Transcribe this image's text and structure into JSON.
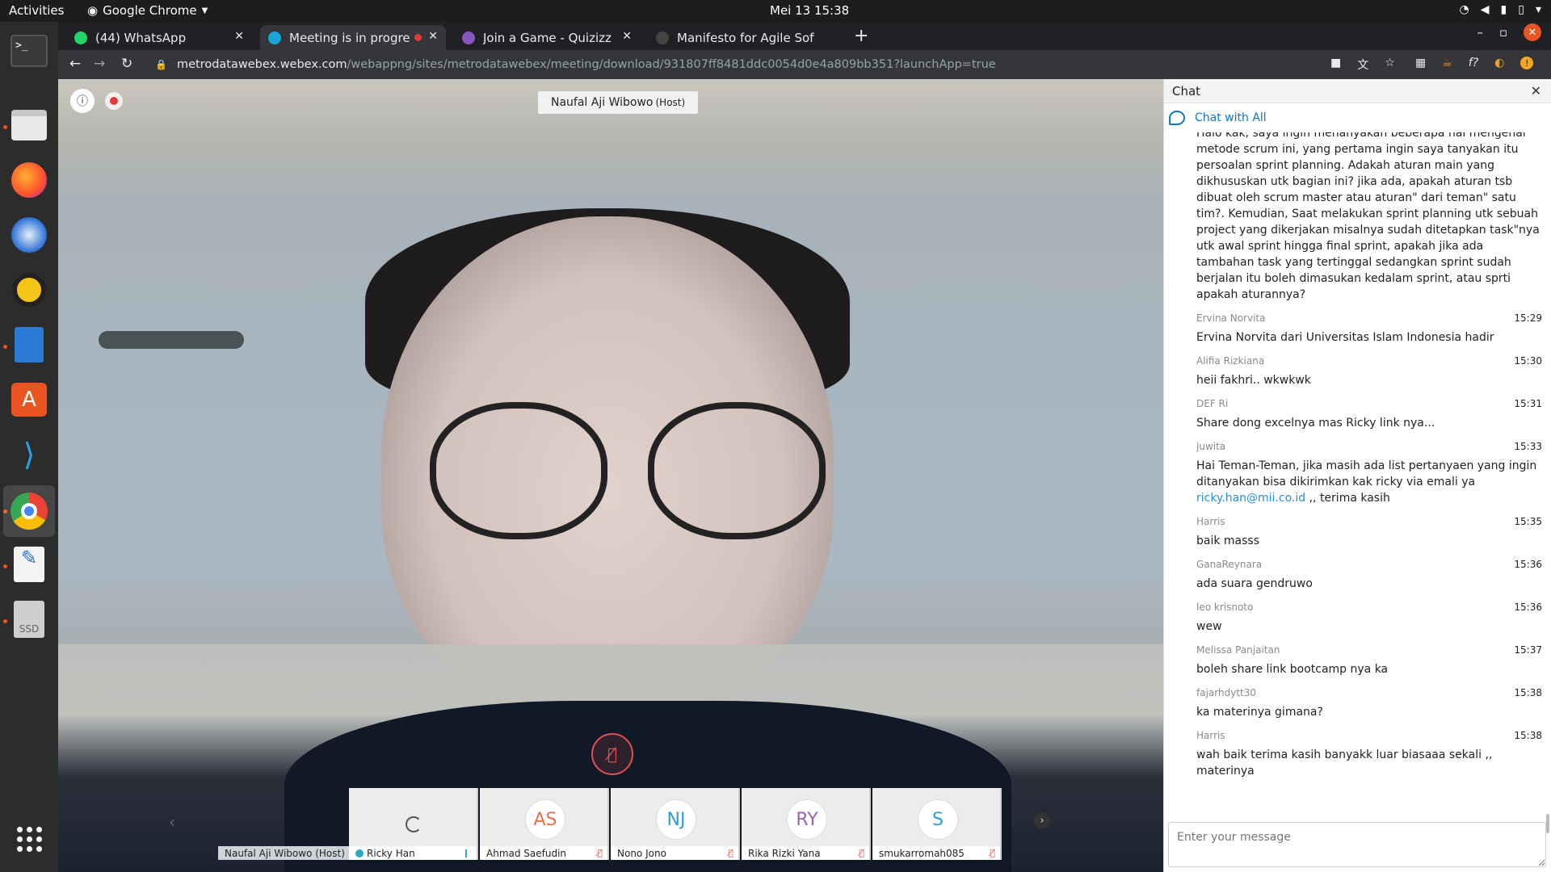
{
  "topbar": {
    "activities": "Activities",
    "app_menu": "Google Chrome",
    "clock": "Mei 13  15:38"
  },
  "dock": {
    "items": [
      "terminal-icon",
      "files-icon",
      "firefox-icon",
      "thunderbird-icon",
      "rhythmbox-icon",
      "writer-icon",
      "software-icon",
      "vscode-icon",
      "chrome-icon",
      "text-editor-icon",
      "ssd-icon"
    ],
    "ssd_label": "SSD"
  },
  "tabs": [
    {
      "title": "(44) WhatsApp",
      "color": "#25d366"
    },
    {
      "title": "Meeting is in progress",
      "color": "#1aa6d6"
    },
    {
      "title": "Join a Game - Quizizz",
      "color": "#8854c0"
    },
    {
      "title": "Manifesto for Agile Software Development",
      "color": "#555555"
    }
  ],
  "url": {
    "domain": "metrodatawebex.webex.com",
    "path": "/webappng/sites/metrodatawebex/meeting/download/931807ff8481ddc0054d0e4a809bb351?launchApp=true"
  },
  "meeting": {
    "active_speaker_name": "Naufal Aji Wibowo",
    "active_speaker_role": "(Host)",
    "host_tile_label": "Naufal Aji Wibowo (Host)",
    "participants": [
      {
        "initials": "",
        "name": "Ricky Han",
        "color": "#555555"
      },
      {
        "initials": "AS",
        "name": "Ahmad Saefudin",
        "color": "#e8734a"
      },
      {
        "initials": "NJ",
        "name": "Nono Jono",
        "color": "#2a9fd6"
      },
      {
        "initials": "RY",
        "name": "Rika Rizki Yana",
        "color": "#9b5fb5"
      },
      {
        "initials": "S",
        "name": "smukarromah085",
        "color": "#2a9fd6"
      }
    ]
  },
  "chat": {
    "header": "Chat",
    "chat_with": "Chat with All",
    "first_message": "Halo kak, saya ingin menanyakan beberapa hal mengenai metode scrum ini, yang pertama ingin saya tanyakan itu persoalan sprint planning. Adakah aturan main yang dikhususkan utk bagian ini? jika ada, apakah aturan tsb dibuat oleh scrum master atau aturan\" dari teman\" satu tim?. Kemudian, Saat melakukan sprint planning utk sebuah project yang dikerjakan misalnya sudah ditetapkan task\"nya utk awal sprint hingga final sprint, apakah jika ada tambahan task yang tertinggal sedangkan sprint sudah berjalan itu boleh dimasukan kedalam sprint, atau sprti apakah aturannya?",
    "messages": [
      {
        "sender": "Ervina Norvita",
        "time": "15:29",
        "text": "Ervina Norvita dari Universitas Islam Indonesia hadir"
      },
      {
        "sender": "Alifia Rizkiana",
        "time": "15:30",
        "text": "heii fakhri.. wkwkwk"
      },
      {
        "sender": "DEF Ri",
        "time": "15:31",
        "text": "Share dong excelnya mas Ricky link nya..."
      },
      {
        "sender": "juwita",
        "time": "15:33",
        "text": "Hai Teman-Teman, jika masih ada list pertanyaen yang ingin ditanyakan bisa dikirimkan kak ricky via emali ya ",
        "link": "ricky.han@mii.co.id",
        "text_after": " ,, terima kasih"
      },
      {
        "sender": "Harris",
        "time": "15:35",
        "text": "baik masss"
      },
      {
        "sender": "GanaReynara",
        "time": "15:36",
        "text": "ada suara gendruwo"
      },
      {
        "sender": "leo krisnoto",
        "time": "15:36",
        "text": "wew"
      },
      {
        "sender": "Melissa Panjaitan",
        "time": "15:37",
        "text": "boleh share link bootcamp nya ka"
      },
      {
        "sender": "fajarhdytt30",
        "time": "15:38",
        "text": "ka materinya gimana?"
      },
      {
        "sender": "Harris",
        "time": "15:38",
        "text": "wah baik terima kasih banyakk luar biasaaa sekali ,, materinya"
      }
    ],
    "input_placeholder": "Enter your message"
  }
}
